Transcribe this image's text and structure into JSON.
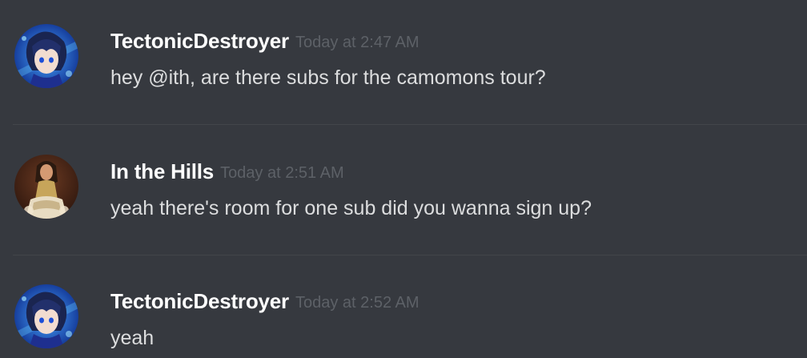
{
  "messages": [
    {
      "author": "TectonicDestroyer",
      "timestamp": "Today at 2:47 AM",
      "text": "hey @ith, are there subs for the camomons tour?",
      "avatar": "anime-character-avatar"
    },
    {
      "author": "In the Hills",
      "timestamp": "Today at 2:51 AM",
      "text": "yeah there's room for one sub did you wanna sign up?",
      "avatar": "person-photo-avatar"
    },
    {
      "author": "TectonicDestroyer",
      "timestamp": "Today at 2:52 AM",
      "text": "yeah",
      "avatar": "anime-character-avatar"
    }
  ],
  "colors": {
    "background": "#36393f",
    "username": "#ffffff",
    "timestamp": "#5d6167",
    "message_text": "#dcddde",
    "divider": "#42454a"
  }
}
